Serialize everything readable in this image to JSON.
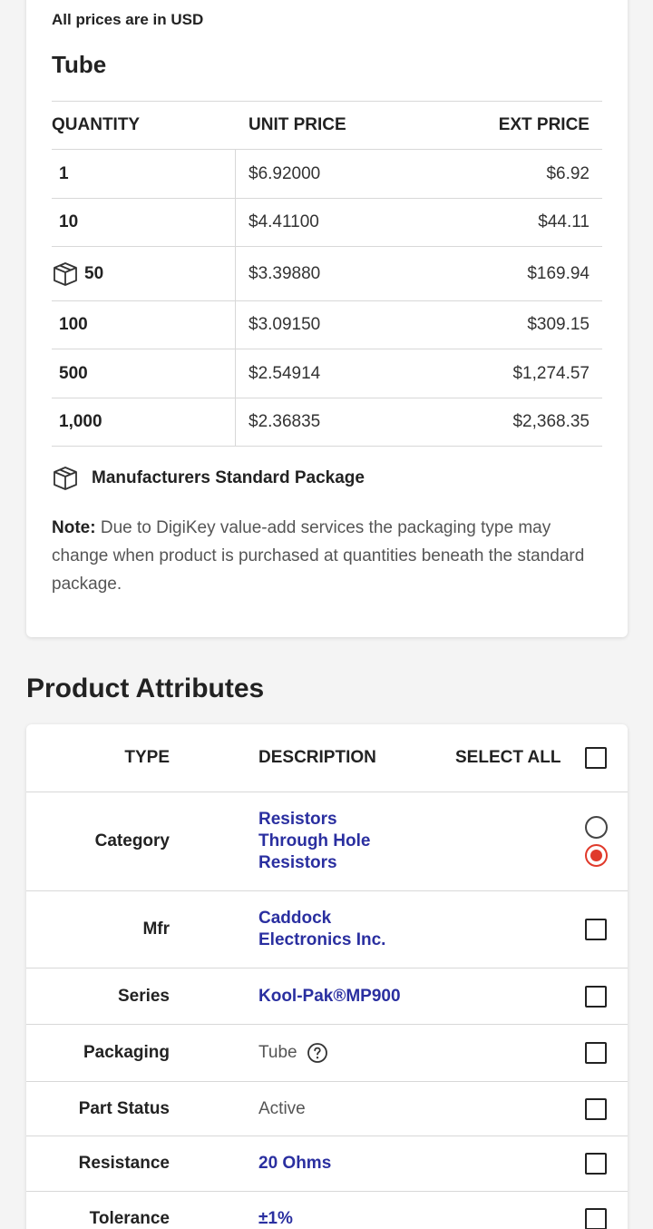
{
  "pricing": {
    "currency_note": "All prices are in USD",
    "package_title": "Tube",
    "headers": {
      "quantity": "QUANTITY",
      "unit_price": "UNIT PRICE",
      "ext_price": "EXT PRICE"
    },
    "rows": [
      {
        "quantity": "1",
        "unit_price": "$6.92000",
        "ext_price": "$6.92",
        "standard_package": false
      },
      {
        "quantity": "10",
        "unit_price": "$4.41100",
        "ext_price": "$44.11",
        "standard_package": false
      },
      {
        "quantity": "50",
        "unit_price": "$3.39880",
        "ext_price": "$169.94",
        "standard_package": true
      },
      {
        "quantity": "100",
        "unit_price": "$3.09150",
        "ext_price": "$309.15",
        "standard_package": false
      },
      {
        "quantity": "500",
        "unit_price": "$2.54914",
        "ext_price": "$1,274.57",
        "standard_package": false
      },
      {
        "quantity": "1,000",
        "unit_price": "$2.36835",
        "ext_price": "$2,368.35",
        "standard_package": false
      }
    ],
    "msp_label": "Manufacturers Standard Package",
    "note_label": "Note:",
    "note_text": " Due to DigiKey value-add services the packaging type may change when product is purchased at quantities beneath the standard package."
  },
  "attributes": {
    "section_title": "Product Attributes",
    "headers": {
      "type": "TYPE",
      "description": "DESCRIPTION",
      "select_all": "SELECT ALL"
    },
    "rows": [
      {
        "type": "Category",
        "description_lines": [
          "Resistors",
          "Through Hole",
          "Resistors"
        ],
        "style": "link",
        "selector": "radio"
      },
      {
        "type": "Mfr",
        "description_lines": [
          "Caddock",
          "Electronics Inc."
        ],
        "style": "link",
        "selector": "checkbox"
      },
      {
        "type": "Series",
        "description_lines": [
          "Kool-Pak®MP900"
        ],
        "style": "link",
        "selector": "checkbox"
      },
      {
        "type": "Packaging",
        "description_lines": [
          "Tube"
        ],
        "style": "plain",
        "help_icon": true,
        "selector": "checkbox"
      },
      {
        "type": "Part Status",
        "description_lines": [
          "Active"
        ],
        "style": "plain",
        "selector": "checkbox"
      },
      {
        "type": "Resistance",
        "description_lines": [
          "20 Ohms"
        ],
        "style": "link",
        "selector": "checkbox"
      },
      {
        "type": "Tolerance",
        "description_lines": [
          "±1%"
        ],
        "style": "link",
        "selector": "checkbox"
      }
    ]
  },
  "colors": {
    "link": "#2a2fa0",
    "radio_selected": "#e03a2b",
    "divider": "#d8d8d8",
    "background": "#f4f4f4"
  }
}
